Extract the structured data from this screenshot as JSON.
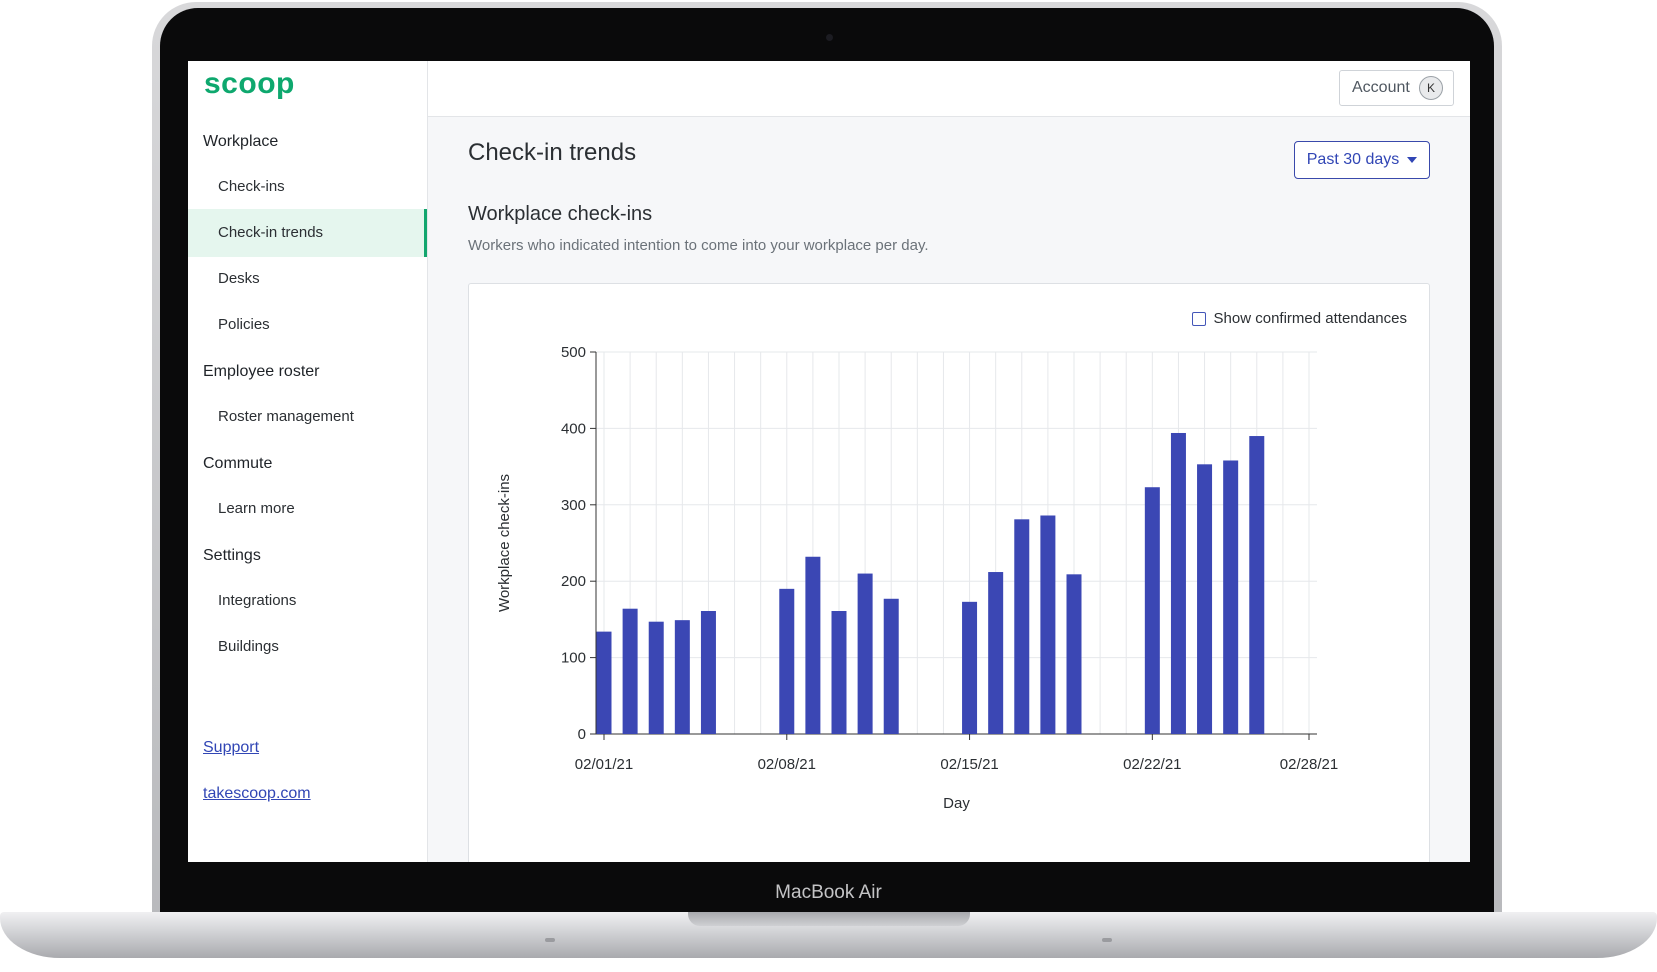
{
  "device": {
    "label": "MacBook Air"
  },
  "brand": {
    "logo_text": "scoop",
    "color": "#0ea86e"
  },
  "sidebar": {
    "sections": [
      {
        "title": "Workplace",
        "items": [
          "Check-ins",
          "Check-in trends",
          "Desks",
          "Policies"
        ]
      },
      {
        "title": "Employee roster",
        "items": [
          "Roster management"
        ]
      },
      {
        "title": "Commute",
        "items": [
          "Learn more"
        ]
      },
      {
        "title": "Settings",
        "items": [
          "Integrations",
          "Buildings"
        ]
      }
    ],
    "active_item": "Check-in trends",
    "links": [
      "Support",
      "takescoop.com"
    ]
  },
  "topbar": {
    "account_label": "Account",
    "avatar_initial": "K"
  },
  "page": {
    "title": "Check-in trends",
    "range_select": "Past 30 days",
    "section_title": "Workplace check-ins",
    "section_subtitle": "Workers who indicated intention to come into your workplace per day.",
    "toggle_label": "Show confirmed attendances",
    "toggle_checked": false
  },
  "colors": {
    "bar": "#3b47b4",
    "accent": "#12a66e",
    "link": "#3146b5"
  },
  "chart_data": {
    "type": "bar",
    "xlabel": "Day",
    "ylabel": "Workplace check-ins",
    "ylim": [
      0,
      500
    ],
    "yticks": [
      0,
      100,
      200,
      300,
      400,
      500
    ],
    "xtick_labels": [
      "02/01/21",
      "02/08/21",
      "02/15/21",
      "02/22/21",
      "02/28/21"
    ],
    "xlim": [
      "02/01/21",
      "02/28/21"
    ],
    "grid": true,
    "x": [
      "02/01/21",
      "02/02/21",
      "02/03/21",
      "02/04/21",
      "02/05/21",
      "02/08/21",
      "02/09/21",
      "02/10/21",
      "02/11/21",
      "02/12/21",
      "02/15/21",
      "02/16/21",
      "02/17/21",
      "02/18/21",
      "02/19/21",
      "02/22/21",
      "02/23/21",
      "02/24/21",
      "02/25/21",
      "02/26/21"
    ],
    "values": [
      134,
      164,
      147,
      149,
      161,
      190,
      232,
      161,
      210,
      177,
      173,
      212,
      281,
      286,
      209,
      323,
      394,
      353,
      358,
      390
    ]
  }
}
